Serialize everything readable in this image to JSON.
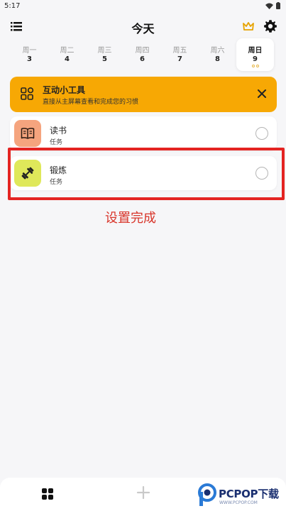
{
  "status_bar": {
    "time": "5:17"
  },
  "header": {
    "title": "今天"
  },
  "week": {
    "days": [
      {
        "name": "周一",
        "num": "3"
      },
      {
        "name": "周二",
        "num": "4"
      },
      {
        "name": "周三",
        "num": "5"
      },
      {
        "name": "周四",
        "num": "6"
      },
      {
        "name": "周五",
        "num": "7"
      },
      {
        "name": "周六",
        "num": "8"
      },
      {
        "name": "周日",
        "num": "9"
      }
    ]
  },
  "widget_banner": {
    "title": "互动小工具",
    "subtitle": "直接从主屏幕查看和完成您的习惯",
    "color": "#f7a804"
  },
  "tasks": [
    {
      "name": "读书",
      "label": "任务",
      "icon": "book-icon",
      "color": "#f5a47e"
    },
    {
      "name": "锻炼",
      "label": "任务",
      "icon": "dumbbell-icon",
      "color": "#dfe85a"
    }
  ],
  "annotation": {
    "text": "设置完成",
    "color": "#d8352a"
  },
  "watermark": {
    "brand": "PCPOP下载",
    "tagline": "WWW.PCPOP.COM"
  }
}
